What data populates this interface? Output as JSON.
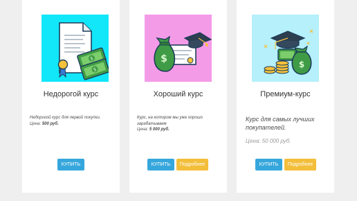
{
  "colors": {
    "buy_button": "#35a7dc",
    "more_button": "#f3be3a",
    "thumb_backgrounds": [
      "#12e6f9",
      "#f49be8",
      "#b5f0fb"
    ]
  },
  "cards": [
    {
      "title": "Недорогой курс",
      "image_icon": "certificate-with-money-icon",
      "desc_text": "Недорогой курс для первой покупки.",
      "price_label": "Цена:",
      "price_value": "500 руб.",
      "buy_label": "КУПИТЬ"
    },
    {
      "title": "Хороший курс",
      "image_icon": "money-bag-diploma-graduation-cap-icon",
      "desc_text": "Курс, на котором мы уже хорошо зарабатываем",
      "price_label": "Цена:",
      "price_value": "5 000 руб.",
      "buy_label": "КУПИТЬ",
      "more_label": "Подробнее"
    },
    {
      "title": "Премиум-курс",
      "image_icon": "graduation-cap-money-coins-icon",
      "desc_text": "Курс для самых лучших покупателей.",
      "price_text": "Цена: 50 000 руб.",
      "buy_label": "КУПИТЬ",
      "more_label": "Подробнее"
    }
  ]
}
